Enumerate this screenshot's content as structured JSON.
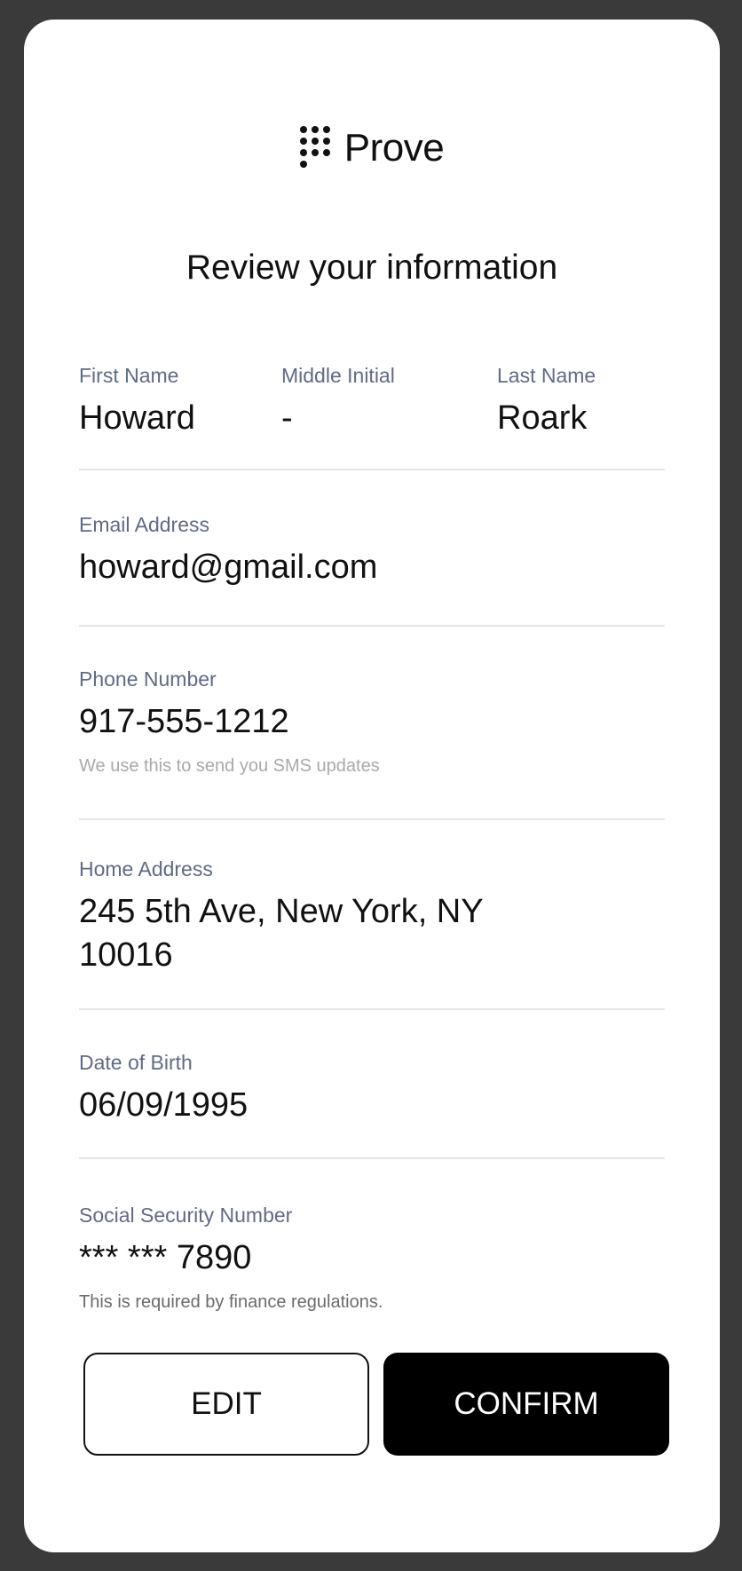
{
  "brand": {
    "name": "Prove",
    "logo_icon": "dot-grid-logo-icon"
  },
  "page": {
    "title": "Review your information"
  },
  "name": {
    "first": {
      "label": "First Name",
      "value": "Howard"
    },
    "middle": {
      "label": "Middle Initial",
      "value": "-"
    },
    "last": {
      "label": "Last Name",
      "value": "Roark"
    }
  },
  "email": {
    "label": "Email Address",
    "value": "howard@gmail.com"
  },
  "phone": {
    "label": "Phone Number",
    "value": "917-555-1212",
    "hint": "We use this to send you SMS updates"
  },
  "address": {
    "label": "Home Address",
    "line1": "245 5th Ave, New York, NY",
    "line2": "10016"
  },
  "dob": {
    "label": "Date of Birth",
    "value": "06/09/1995"
  },
  "ssn": {
    "label": "Social Security Number",
    "value": "*** *** 7890",
    "hint": "This is required by finance regulations."
  },
  "actions": {
    "edit_label": "EDIT",
    "confirm_label": "CONFIRM"
  },
  "colors": {
    "background": "#3a3a3a",
    "card": "#ffffff",
    "label": "#5f6b86",
    "confirm_button": "#000000"
  }
}
